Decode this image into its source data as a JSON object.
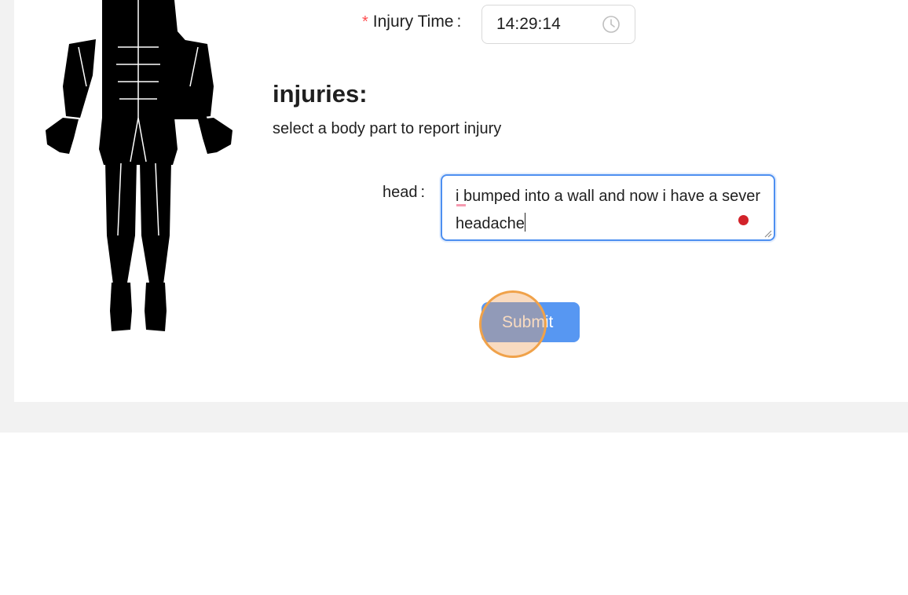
{
  "form": {
    "injury_time": {
      "required_mark": "*",
      "label": "Injury Time",
      "colon": ":",
      "value": "14:29:14",
      "icon": "clock-icon"
    },
    "injuries": {
      "title": "injuries:",
      "subtitle": "select a body part to report injury",
      "entries": [
        {
          "body_part": "head",
          "colon": ":",
          "text": "i bumped into a wall and now i have a sever headache"
        }
      ]
    },
    "submit_label": "Submit"
  },
  "colors": {
    "accent": "#5797f2",
    "focus_border": "#4d8ff0",
    "required": "#ff4d4f",
    "record_dot": "#d2232a",
    "page_background": "#f2f2f2"
  },
  "icons": [
    "body-figure",
    "clock-icon",
    "record-indicator",
    "resize-grip-icon"
  ]
}
